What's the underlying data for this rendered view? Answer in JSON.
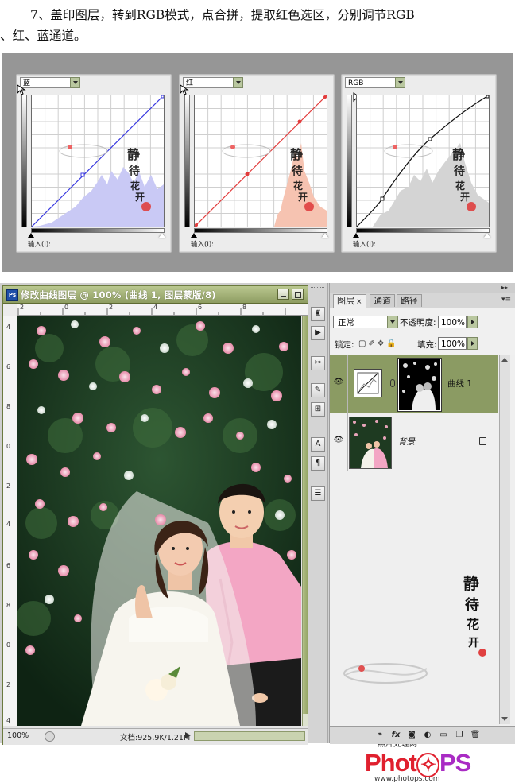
{
  "instruction": {
    "line1": "7、盖印图层，转到RGB模式，点合拼，提取红色选区，分别调节RGB",
    "line2": "、红、蓝通道。"
  },
  "curves": [
    {
      "channel": "蓝",
      "input_label": "输入(I):",
      "color": "#3a3ae0",
      "fill": "#c9c9f5"
    },
    {
      "channel": "红",
      "input_label": "输入(I):",
      "color": "#e23b3b",
      "fill": "#f6c3b1"
    },
    {
      "channel": "RGB",
      "input_label": "输入(I):",
      "color": "#111111",
      "fill": "#d4d4d4"
    }
  ],
  "document": {
    "title": "修改曲线图层 @ 100% (曲线 1, 图层蒙版/8)",
    "ps_icon": "Ps",
    "ruler_h": [
      "2",
      "0",
      "2",
      "4",
      "6",
      "8"
    ],
    "ruler_v": [
      "4",
      "6",
      "8",
      "0",
      "2",
      "4",
      "6",
      "8",
      "0",
      "2",
      "4"
    ],
    "zoom": "100%",
    "doc_info": "文档:925.9K/1.21M"
  },
  "layers_panel": {
    "tabs": [
      "图层",
      "通道",
      "路径"
    ],
    "blend_mode": "正常",
    "opacity_label": "不透明度:",
    "opacity": "100%",
    "lock_label": "锁定:",
    "fill_label": "填充:",
    "fill": "100%",
    "layers": [
      {
        "name": "曲线 1",
        "selected": true
      },
      {
        "name": "背景",
        "selected": false
      }
    ]
  },
  "branding": {
    "site_name": "照片处理网",
    "logo": "PhotoPS",
    "url": "www.photops.com"
  },
  "colors": {
    "selected_layer": "#8b9b63",
    "title_bar": "#9aa86d",
    "blue_curve": "#3a3ae0",
    "red_curve": "#e23b3b"
  }
}
